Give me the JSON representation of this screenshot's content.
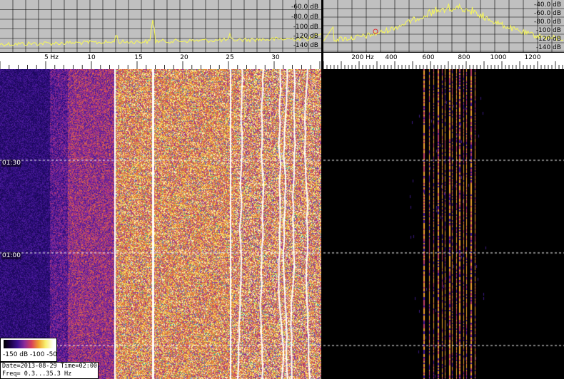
{
  "left": {
    "db_labels": [
      "-60.0 dB",
      "-80.0 dB",
      "-100 dB",
      "-120 dB",
      "-140 dB"
    ],
    "freq_ticks": [
      "5 Hz",
      "10",
      "15",
      "20",
      "25",
      "30"
    ],
    "time_labels": [
      "01:30",
      "01:00"
    ],
    "colorbar_label": "-150 dB -100    -50",
    "info": {
      "line1": "Date=2013-08-29 Time=02:00",
      "line2": "Freq= 0.3...35.3 Hz"
    }
  },
  "right": {
    "db_labels": [
      "-40.0 dB",
      "-60.0 dB",
      "-80.0 dB",
      "-100 dB",
      "-120 dB",
      "-140 dB"
    ],
    "freq_ticks": [
      "200 Hz",
      "400",
      "600",
      "800",
      "1000",
      "1200"
    ]
  },
  "colors": {
    "spectrum_bg": "#c0c0c0",
    "spectrum_trace": "#f8f858",
    "grid": "#000000",
    "waterfall_dark": "#000000",
    "waterfall_purple": "#2a0c78",
    "waterfall_hot": "#f0a030"
  }
}
